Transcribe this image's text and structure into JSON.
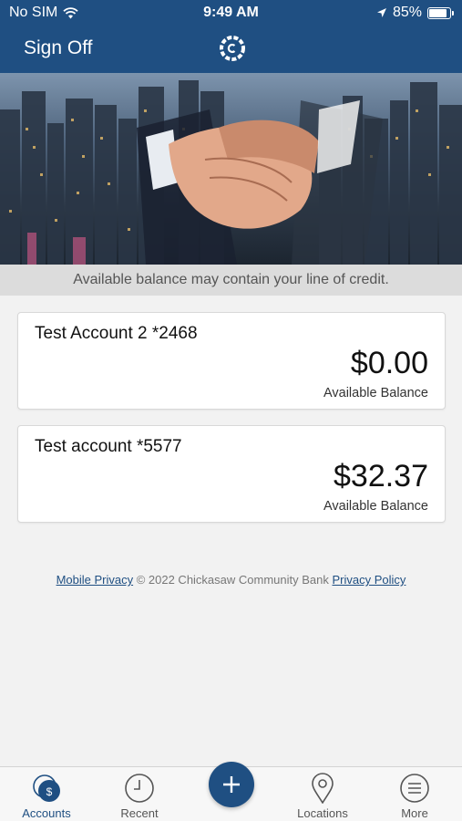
{
  "status_bar": {
    "carrier": "No SIM",
    "time": "9:49 AM",
    "battery": "85%",
    "battery_level": 0.85
  },
  "header": {
    "sign_off_label": "Sign Off",
    "logo_icon": "bank-logo-icon"
  },
  "notice": "Available balance may contain your line of credit.",
  "accounts": [
    {
      "name": "Test Account 2 *2468",
      "balance": "$0.00",
      "balance_label": "Available Balance"
    },
    {
      "name": "Test account *5577",
      "balance": "$32.37",
      "balance_label": "Available Balance"
    }
  ],
  "footer": {
    "mobile_privacy": "Mobile Privacy",
    "copyright": " © 2022 Chickasaw Community Bank ",
    "privacy_policy": "Privacy Policy"
  },
  "tabs": [
    {
      "label": "Accounts",
      "icon": "accounts-icon",
      "active": true
    },
    {
      "label": "Recent",
      "icon": "clock-icon",
      "active": false
    },
    {
      "label": "Locations",
      "icon": "location-pin-icon",
      "active": false
    },
    {
      "label": "More",
      "icon": "menu-icon",
      "active": false
    }
  ],
  "colors": {
    "primary": "#1f4f82",
    "background": "#f2f2f2"
  }
}
